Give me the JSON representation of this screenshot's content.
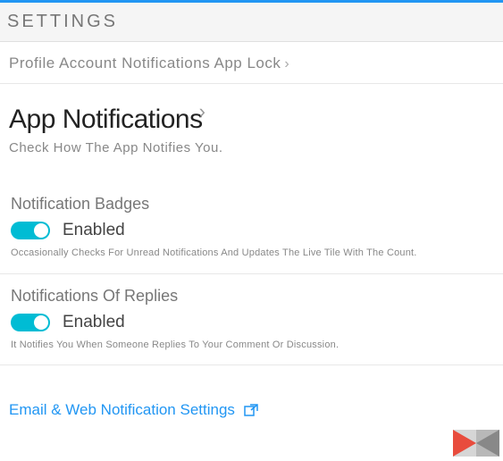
{
  "header": {
    "title": "SETTINGS"
  },
  "tabs": {
    "combined": "Profile Account Notifications App Lock"
  },
  "page": {
    "title": "App Notifications",
    "subtitle": "Check How The App Notifies You."
  },
  "sections": {
    "badges": {
      "title": "Notification Badges",
      "state": "Enabled",
      "desc": "Occasionally Checks For Unread Notifications And Updates The Live Tile With The Count."
    },
    "replies": {
      "title": "Notifications Of Replies",
      "state": "Enabled",
      "desc": "It Notifies You When Someone Replies To Your Comment Or Discussion."
    }
  },
  "link": {
    "label": "Email & Web Notification Settings"
  },
  "colors": {
    "accent": "#2196f3",
    "toggle": "#00bcd4"
  }
}
